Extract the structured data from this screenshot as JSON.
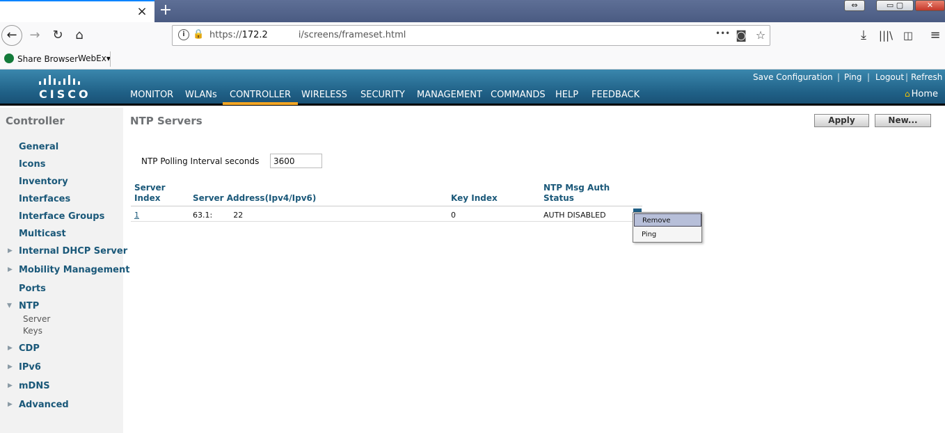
{
  "browser": {
    "tab_close": "×",
    "new_tab": "+",
    "url_prefix": "https://",
    "url_host": "172.2",
    "url_path": "i/screens/frameset.html",
    "url_more": "•••",
    "bookmarks": [
      {
        "label": "Share Browser"
      },
      {
        "label": "WebEx▾"
      }
    ]
  },
  "header": {
    "logo_text": "CISCO",
    "menu": [
      {
        "label": "MONITOR",
        "active": false
      },
      {
        "label": "WLANs",
        "active": false
      },
      {
        "label": "CONTROLLER",
        "active": true
      },
      {
        "label": "WIRELESS",
        "active": false
      },
      {
        "label": "SECURITY",
        "active": false
      },
      {
        "label": "MANAGEMENT",
        "active": false
      },
      {
        "label": "COMMANDS",
        "active": false
      },
      {
        "label": "HELP",
        "active": false
      },
      {
        "label": "FEEDBACK",
        "active": false
      }
    ],
    "utility": [
      {
        "label": "Save Configuration"
      },
      {
        "label": "Ping"
      },
      {
        "label": "Logout"
      },
      {
        "label": "Refresh"
      }
    ],
    "home_label": "Home",
    "accent_color": "#f5a623"
  },
  "sidebar": {
    "title": "Controller",
    "items": [
      {
        "label": "General",
        "expandable": false
      },
      {
        "label": "Icons",
        "expandable": false
      },
      {
        "label": "Inventory",
        "expandable": false
      },
      {
        "label": "Interfaces",
        "expandable": false
      },
      {
        "label": "Interface Groups",
        "expandable": false
      },
      {
        "label": "Multicast",
        "expandable": false
      },
      {
        "label": "Internal DHCP Server",
        "expandable": true
      },
      {
        "label": "Mobility Management",
        "expandable": true
      },
      {
        "label": "Ports",
        "expandable": false
      },
      {
        "label": "NTP",
        "expandable": true,
        "expanded": true
      },
      {
        "label": "CDP",
        "expandable": true
      },
      {
        "label": "IPv6",
        "expandable": true
      },
      {
        "label": "mDNS",
        "expandable": true
      },
      {
        "label": "Advanced",
        "expandable": true
      }
    ],
    "ntp_sub": [
      {
        "label": "Server"
      },
      {
        "label": "Keys"
      }
    ]
  },
  "main": {
    "title": "NTP Servers",
    "apply_label": "Apply",
    "new_label": "New...",
    "poll_label": "NTP Polling Interval seconds",
    "poll_value": "3600",
    "columns": {
      "index_1": "Server",
      "index_2": "Index",
      "address": "Server Address(Ipv4/Ipv6)",
      "key": "Key Index",
      "auth_1": "NTP Msg Auth",
      "auth_2": "Status"
    },
    "rows": [
      {
        "index": "1",
        "address_a": "63.1:",
        "address_b": "22",
        "key": "0",
        "auth": "AUTH DISABLED"
      }
    ],
    "context_menu": [
      {
        "label": "Remove",
        "highlighted": true
      },
      {
        "label": "Ping",
        "highlighted": false
      }
    ]
  }
}
